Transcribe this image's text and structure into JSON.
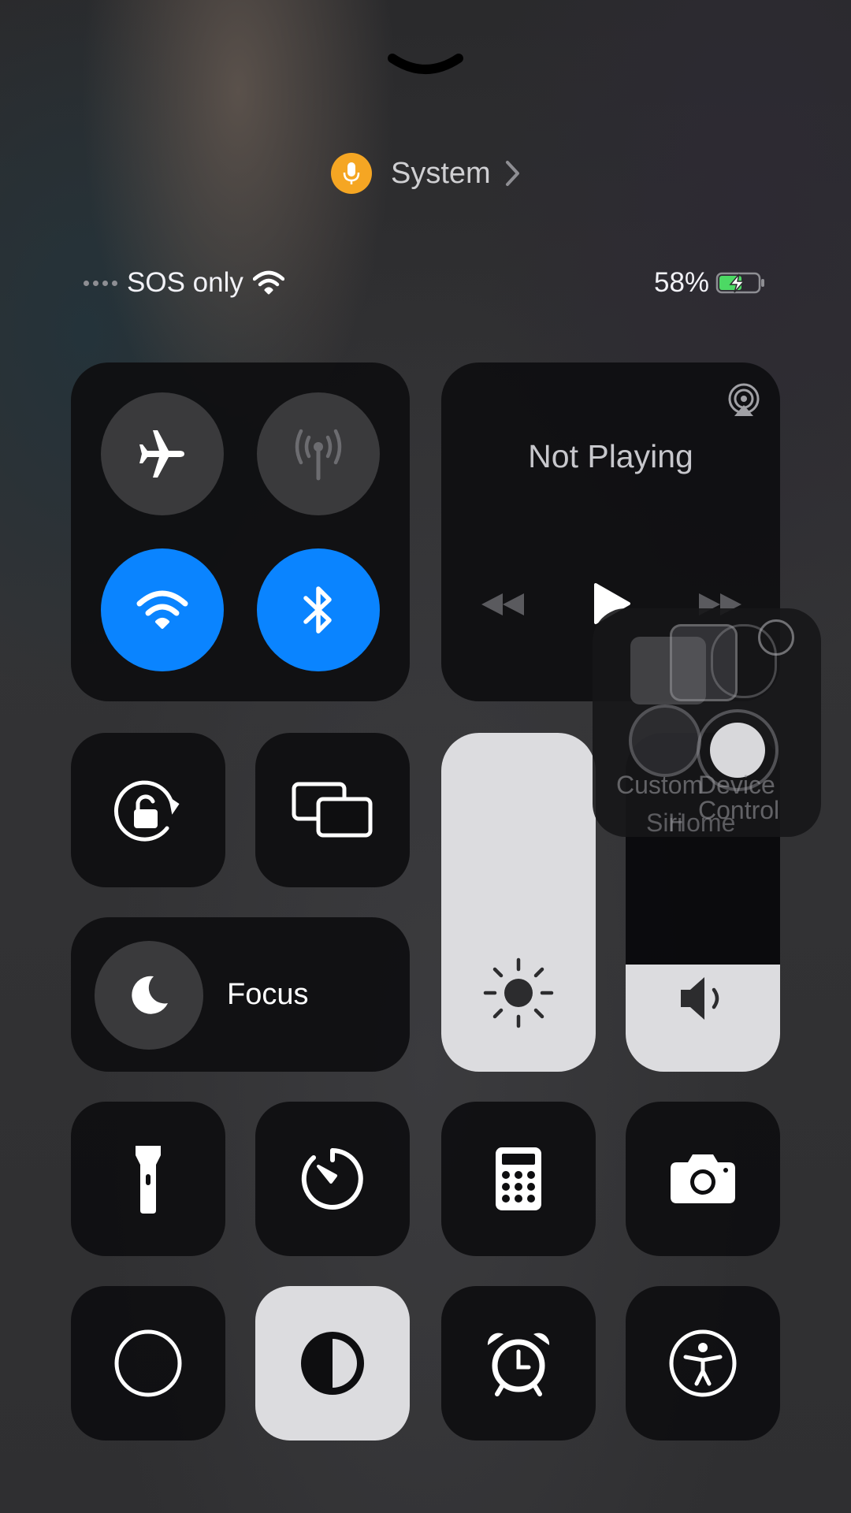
{
  "top_indicator": {
    "label": "System"
  },
  "status_bar": {
    "carrier": "SOS only",
    "battery_percent": "58%",
    "battery_level": 0.58
  },
  "connectivity": {
    "airplane_mode": false,
    "cellular_data": false,
    "wifi": true,
    "bluetooth": true
  },
  "media": {
    "status": "Not Playing"
  },
  "focus": {
    "label": "Focus"
  },
  "sliders": {
    "brightness_level": 1.0,
    "volume_level": 0.4
  },
  "assistive_touch": {
    "labels": [
      "Custom",
      "Device",
      "Control",
      "Siri",
      "Home"
    ]
  },
  "colors": {
    "accent_blue": "#0a84ff",
    "mic_orange": "#f5a623",
    "battery_green": "#4cd964"
  }
}
